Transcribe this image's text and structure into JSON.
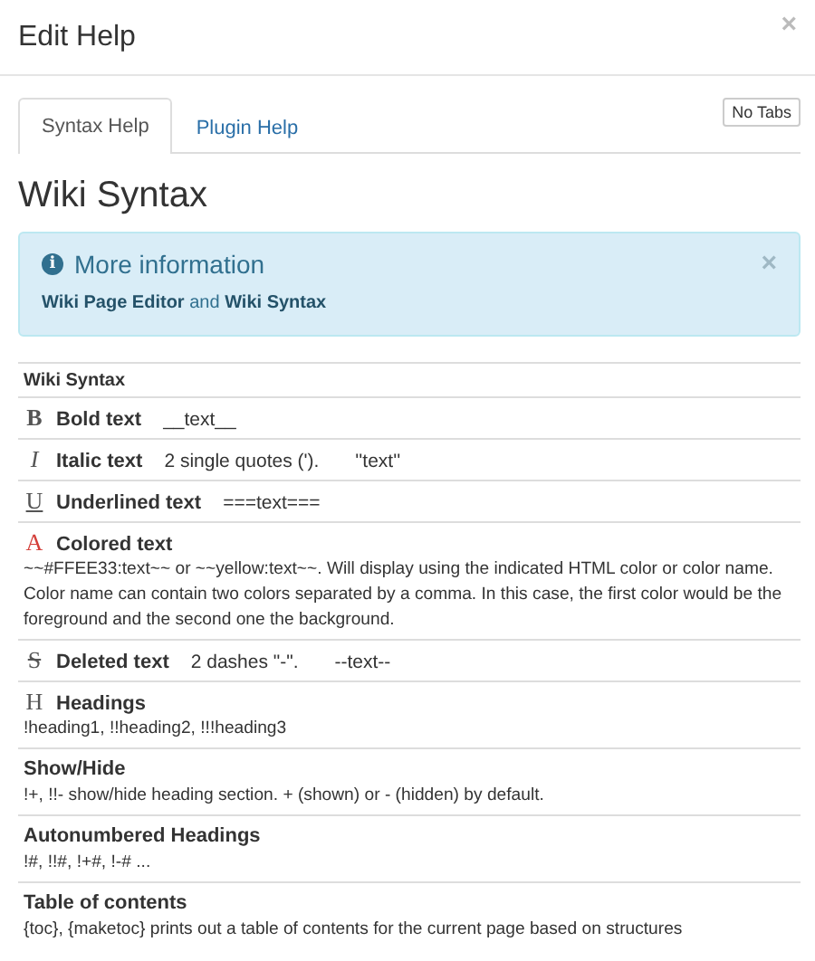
{
  "dialog": {
    "title": "Edit Help",
    "close": "×"
  },
  "tabs": [
    {
      "label": "Syntax Help",
      "selected": true
    },
    {
      "label": "Plugin Help",
      "selected": false
    }
  ],
  "no_tabs_button": "No Tabs",
  "heading": "Wiki Syntax",
  "alert": {
    "icon": "i",
    "title": "More information",
    "close": "×",
    "text": "**Wiki Page Editor** and **Wiki Syntax**"
  },
  "table": {
    "header": "Wiki Syntax",
    "rows": [
      {
        "kind": "inline",
        "icon": {
          "glyph": "B",
          "kind": "bold"
        },
        "label": "Bold text",
        "parts": [
          "__text__"
        ]
      },
      {
        "kind": "inline",
        "icon": {
          "glyph": "I",
          "kind": "italic"
        },
        "label": "Italic text",
        "parts": [
          "2 single quotes (').",
          "''text''"
        ]
      },
      {
        "kind": "inline",
        "icon": {
          "glyph": "U",
          "kind": "underline"
        },
        "label": "Underlined text",
        "parts": [
          "===text==="
        ]
      },
      {
        "kind": "block",
        "icon": {
          "glyph": "A",
          "kind": "red"
        },
        "label": "Colored text",
        "parts": [
          "~~#FFEE33:text~~ or ~~yellow:text~~. Will display using the indicated HTML color or color name. Color name can contain two colors separated by a comma. In this case, the first color would be the foreground and the second one the background."
        ]
      },
      {
        "kind": "inline",
        "icon": {
          "glyph": "S",
          "kind": "strike"
        },
        "label": "Deleted text",
        "parts": [
          "2 dashes \"-\".",
          "--text--"
        ]
      },
      {
        "kind": "block",
        "icon": {
          "glyph": "H",
          "kind": "plain"
        },
        "label": "Headings",
        "parts": [
          "!heading1, !!heading2, !!!heading3"
        ]
      },
      {
        "kind": "block",
        "label": "Show/Hide",
        "parts": [
          "!+, !!- show/hide heading section. + (shown) or - (hidden) by default."
        ]
      },
      {
        "kind": "block",
        "label": "Autonumbered Headings",
        "parts": [
          "!#, !!#, !+#, !-# ..."
        ]
      },
      {
        "kind": "block",
        "label": "Table of contents",
        "parts": [
          "{toc}, {maketoc} prints out a table of contents for the current page based on structures"
        ]
      }
    ]
  }
}
